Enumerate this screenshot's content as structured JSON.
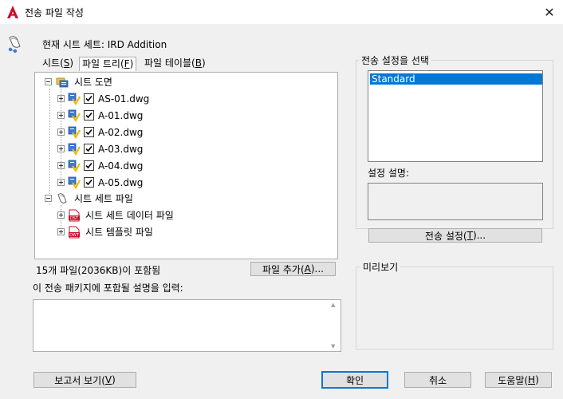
{
  "window": {
    "title": "전송 파일 작성",
    "close_glyph": "✕"
  },
  "header": {
    "current_sheet_set": "현재 시트 세트: IRD Addition"
  },
  "tabs": [
    {
      "pre": "시트(",
      "key": "S",
      "post": ")"
    },
    {
      "pre": "파일 트리(",
      "key": "F",
      "post": ")"
    },
    {
      "pre": "파일 테이블(",
      "key": "B",
      "post": ")"
    }
  ],
  "tree": {
    "root1": {
      "label": "시트 도면",
      "icon": "sheets-folder-icon"
    },
    "files": [
      "AS-01.dwg",
      "A-01.dwg",
      "A-02.dwg",
      "A-03.dwg",
      "A-04.dwg",
      "A-05.dwg"
    ],
    "root2": {
      "label": "시트 세트 파일",
      "icon": "sheetset-file-icon"
    },
    "sub": [
      {
        "label": "시트 세트 데이터 파일",
        "tag": "DST"
      },
      {
        "label": "시트 템플릿 파일",
        "tag": "DWT"
      }
    ]
  },
  "summary": "15개 파일(2036KB)이 포함됨",
  "add_file_button": {
    "pre": "파일 추가(",
    "key": "A",
    "post": ")..."
  },
  "notes_label": "이 전송 패키지에 포함될 설명을 입력:",
  "notes_value": "",
  "transmittal_setup": {
    "group_label": "전송 설정을 선택",
    "items": [
      "Standard"
    ],
    "desc_label": "설정 설명:",
    "setup_button": {
      "pre": "전송 설정(",
      "key": "T",
      "post": ")..."
    }
  },
  "preview_label": "미리보기",
  "footer": {
    "view_report": {
      "pre": "보고서 보기(",
      "key": "V",
      "post": ")"
    },
    "ok": "확인",
    "cancel": "취소",
    "help": {
      "pre": "도움말(",
      "key": "H",
      "post": ")"
    }
  },
  "colors": {
    "accent": "#0078d7",
    "autocad_red": "#c8102e"
  }
}
